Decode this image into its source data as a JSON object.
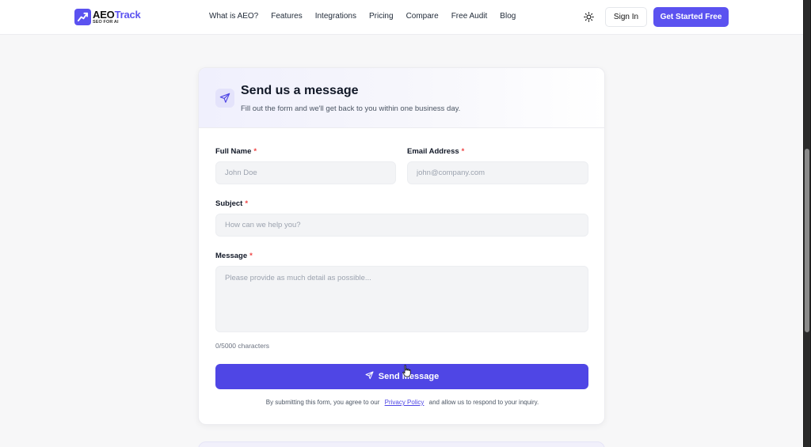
{
  "header": {
    "logo": {
      "name_prefix": "AEO",
      "name_suffix": "Track",
      "tagline": "SEO FOR AI"
    },
    "nav": [
      "What is AEO?",
      "Features",
      "Integrations",
      "Pricing",
      "Compare",
      "Free Audit",
      "Blog"
    ],
    "sign_in_label": "Sign In",
    "get_started_label": "Get Started Free"
  },
  "form": {
    "title": "Send us a message",
    "subtitle": "Fill out the form and we'll get back to you within one business day.",
    "required_mark": "*",
    "full_name": {
      "label": "Full Name",
      "placeholder": "John Doe",
      "value": ""
    },
    "email": {
      "label": "Email Address",
      "placeholder": "john@company.com",
      "value": ""
    },
    "subject": {
      "label": "Subject",
      "placeholder": "How can we help you?",
      "value": ""
    },
    "message": {
      "label": "Message",
      "placeholder": "Please provide as much detail as possible...",
      "value": ""
    },
    "counter": "0/5000 characters",
    "submit_label": "Send Message",
    "terms": {
      "before": "By submitting this form, you agree to our",
      "link": "Privacy Policy",
      "after": "and allow us to respond to your inquiry."
    }
  },
  "colors": {
    "accent": "#5b52f0",
    "submit": "#4f46e5",
    "required": "#ef4444"
  },
  "icons": {
    "logo": "chart-arrow-icon",
    "theme": "sun-icon",
    "form": "send-icon",
    "submit": "send-icon"
  }
}
